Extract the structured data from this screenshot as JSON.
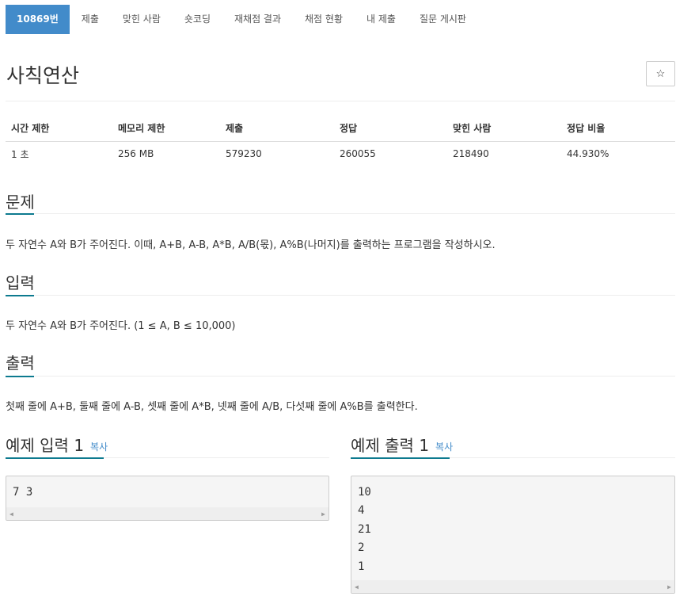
{
  "tabs": [
    {
      "label": "10869번",
      "active": true
    },
    {
      "label": "제출"
    },
    {
      "label": "맞힌 사람"
    },
    {
      "label": "숏코딩"
    },
    {
      "label": "재채점 결과"
    },
    {
      "label": "채점 현황"
    },
    {
      "label": "내 제출"
    },
    {
      "label": "질문 게시판"
    }
  ],
  "problem": {
    "title": "사칙연산",
    "star_label": "☆"
  },
  "info": {
    "headers": [
      "시간 제한",
      "메모리 제한",
      "제출",
      "정답",
      "맞힌 사람",
      "정답 비율"
    ],
    "values": [
      "1 초",
      "256 MB",
      "579230",
      "260055",
      "218490",
      "44.930%"
    ]
  },
  "sections": {
    "description": {
      "title": "문제",
      "text": "두 자연수 A와 B가 주어진다. 이때, A+B, A-B, A*B, A/B(몫), A%B(나머지)를 출력하는 프로그램을 작성하시오."
    },
    "input": {
      "title": "입력",
      "text": "두 자연수 A와 B가 주어진다. (1 ≤ A, B ≤ 10,000)"
    },
    "output": {
      "title": "출력",
      "text": "첫째 줄에 A+B, 둘째 줄에 A-B, 셋째 줄에 A*B, 넷째 줄에 A/B, 다섯째 줄에 A%B를 출력한다."
    }
  },
  "samples": {
    "input": {
      "title": "예제 입력 1",
      "copy_label": "복사",
      "text": "7 3"
    },
    "output": {
      "title": "예제 출력 1",
      "copy_label": "복사",
      "text": "10\n4\n21\n2\n1"
    }
  },
  "colors": {
    "accent": "#428bca",
    "headline_underline": "#0d7a8f"
  }
}
